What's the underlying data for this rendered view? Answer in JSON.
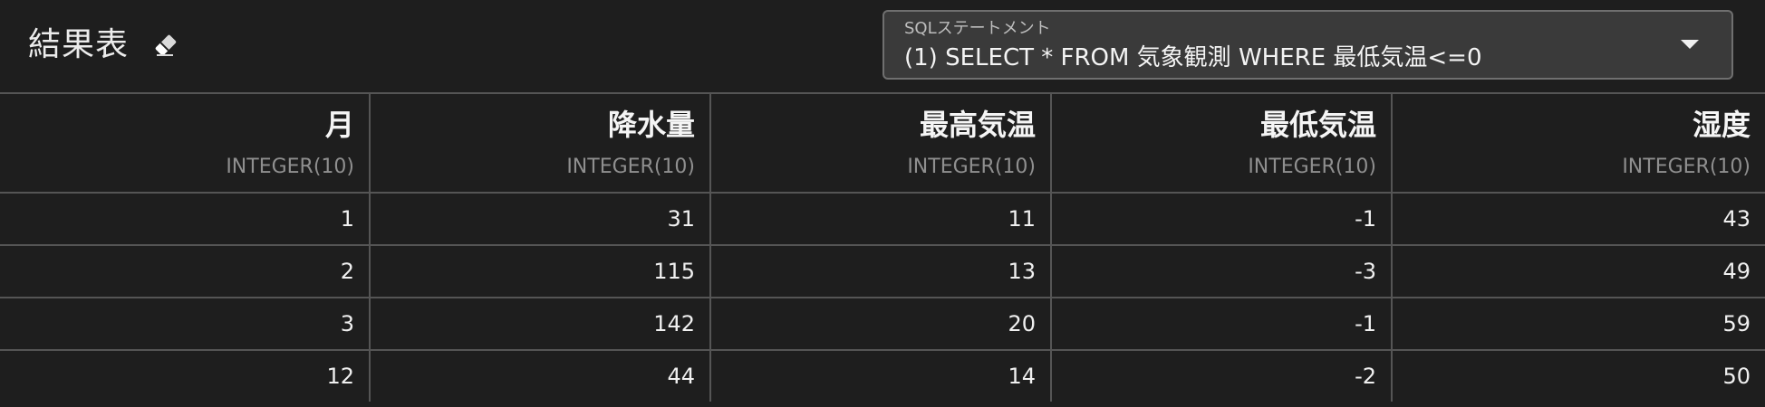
{
  "header": {
    "title": "結果表",
    "clear_icon": "eraser-icon"
  },
  "sql_select": {
    "label": "SQLステートメント",
    "value": "(1) SELECT * FROM 気象観測 WHERE 最低気温<=0",
    "icon": "chevron-down-icon"
  },
  "table": {
    "columns": [
      {
        "name": "月",
        "type": "INTEGER(10)"
      },
      {
        "name": "降水量",
        "type": "INTEGER(10)"
      },
      {
        "name": "最高気温",
        "type": "INTEGER(10)"
      },
      {
        "name": "最低気温",
        "type": "INTEGER(10)"
      },
      {
        "name": "湿度",
        "type": "INTEGER(10)"
      }
    ],
    "rows": [
      [
        "1",
        "31",
        "11",
        "-1",
        "43"
      ],
      [
        "2",
        "115",
        "13",
        "-3",
        "49"
      ],
      [
        "3",
        "142",
        "20",
        "-1",
        "59"
      ],
      [
        "12",
        "44",
        "14",
        "-2",
        "50"
      ]
    ]
  },
  "colors": {
    "background": "#1e1e1e",
    "select_background": "#3a3a3a",
    "border": "#555555",
    "text": "#ececec",
    "muted_text": "#8f8f8f"
  }
}
